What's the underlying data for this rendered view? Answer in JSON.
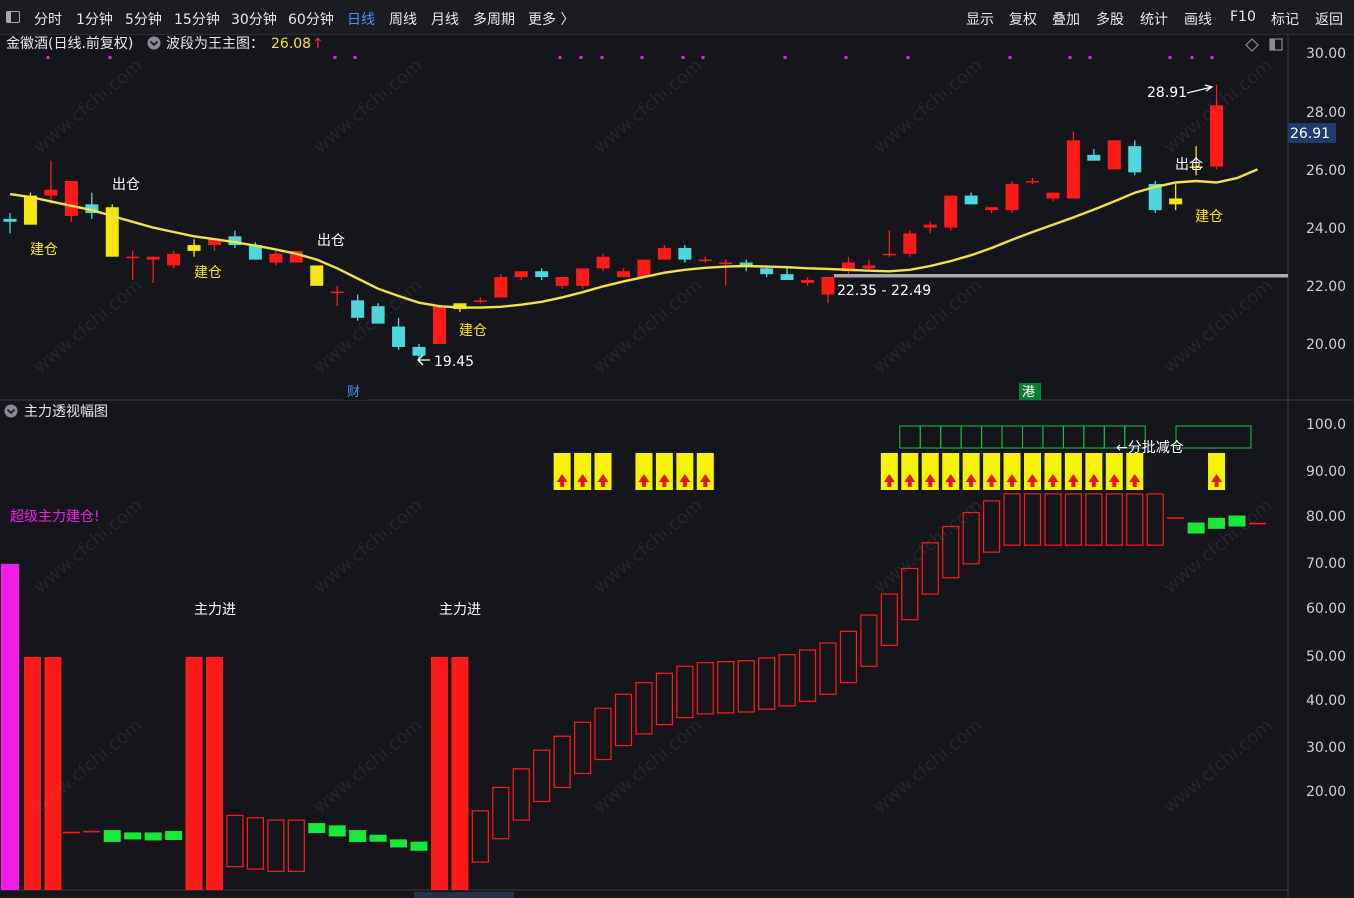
{
  "toolbar": {
    "periods": [
      "分时",
      "1分钟",
      "5分钟",
      "15分钟",
      "30分钟",
      "60分钟",
      "日线",
      "周线",
      "月线",
      "多周期",
      "更多 〉"
    ],
    "active_period": "日线",
    "right_items": [
      "显示",
      "复权",
      "叠加",
      "多股",
      "统计",
      "画线",
      "F10",
      "标记",
      "返回"
    ]
  },
  "main_panel": {
    "title": "金徽酒(日线.前复权)",
    "indicator_name": "波段为王主图：",
    "indicator_value": "26.08",
    "indicator_arrow": "↑",
    "price_axis": [
      "30.00",
      "28.00",
      "26.00",
      "24.00",
      "22.00",
      "20.00"
    ],
    "current_price": "26.91",
    "high_label": "28.91",
    "low_label": "19.45",
    "range_label": "22.35 - 22.49",
    "markers": {
      "cai": "财",
      "gang": "港"
    },
    "signals": [
      {
        "text": "建仓",
        "type": "build"
      },
      {
        "text": "出仓",
        "type": "exit"
      },
      {
        "text": "建仓",
        "type": "build"
      },
      {
        "text": "出仓",
        "type": "exit"
      },
      {
        "text": "建仓",
        "type": "build"
      },
      {
        "text": "出仓",
        "type": "exit"
      },
      {
        "text": "建仓",
        "type": "build"
      }
    ]
  },
  "sub_panel": {
    "title": "主力透视幅图",
    "value_axis": [
      "100.0",
      "90.00",
      "80.00",
      "70.00",
      "60.00",
      "50.00",
      "40.00",
      "30.00",
      "20.00"
    ],
    "super_label": "超级主力建仓!",
    "main_force_label": "主力进",
    "reduce_label": "←分批减仓"
  },
  "watermark": "www.cfchi.com",
  "colors": {
    "background": "#15161c",
    "up": "#ff1a1a",
    "down": "#4fd6dc",
    "ma": "#f2e24a",
    "signal": "#f5e60d",
    "green_bar": "#18e83a",
    "magenta": "#f01ee6",
    "accent": "#4f8ff7"
  },
  "chart_data": {
    "type": "candlestick",
    "price_range": [
      19,
      30.3
    ],
    "candles": [
      {
        "o": 24.3,
        "h": 24.5,
        "l": 23.8,
        "c": 24.2
      },
      {
        "o": 25.1,
        "h": 25.2,
        "l": 24.1,
        "c": 24.1
      },
      {
        "o": 25.1,
        "h": 26.3,
        "l": 24.8,
        "c": 25.3
      },
      {
        "o": 24.4,
        "h": 25.6,
        "l": 24.2,
        "c": 25.6
      },
      {
        "o": 24.8,
        "h": 25.2,
        "l": 24.3,
        "c": 24.5
      },
      {
        "o": 24.7,
        "h": 24.8,
        "l": 23.0,
        "c": 23.0
      },
      {
        "o": 23.0,
        "h": 23.2,
        "l": 22.2,
        "c": 23.0
      },
      {
        "o": 22.9,
        "h": 23.0,
        "l": 22.1,
        "c": 23.0
      },
      {
        "o": 22.7,
        "h": 23.2,
        "l": 22.6,
        "c": 23.1
      },
      {
        "o": 23.2,
        "h": 23.6,
        "l": 23.0,
        "c": 23.4
      },
      {
        "o": 23.4,
        "h": 23.6,
        "l": 23.2,
        "c": 23.6
      },
      {
        "o": 23.7,
        "h": 23.9,
        "l": 23.3,
        "c": 23.4
      },
      {
        "o": 23.4,
        "h": 23.5,
        "l": 22.9,
        "c": 22.9
      },
      {
        "o": 22.8,
        "h": 23.2,
        "l": 22.7,
        "c": 23.1
      },
      {
        "o": 22.8,
        "h": 23.2,
        "l": 22.8,
        "c": 23.2
      },
      {
        "o": 22.7,
        "h": 22.7,
        "l": 22.0,
        "c": 22.0
      },
      {
        "o": 21.8,
        "h": 22.0,
        "l": 21.3,
        "c": 21.8
      },
      {
        "o": 21.5,
        "h": 21.7,
        "l": 20.8,
        "c": 20.9
      },
      {
        "o": 21.3,
        "h": 21.4,
        "l": 20.7,
        "c": 20.7
      },
      {
        "o": 20.6,
        "h": 20.9,
        "l": 19.8,
        "c": 19.9
      },
      {
        "o": 19.9,
        "h": 20.0,
        "l": 19.45,
        "c": 19.6
      },
      {
        "o": 20.0,
        "h": 21.3,
        "l": 20.0,
        "c": 21.3
      },
      {
        "o": 21.2,
        "h": 21.4,
        "l": 21.1,
        "c": 21.4
      },
      {
        "o": 21.5,
        "h": 21.6,
        "l": 21.4,
        "c": 21.5
      },
      {
        "o": 21.6,
        "h": 22.4,
        "l": 21.6,
        "c": 22.3
      },
      {
        "o": 22.3,
        "h": 22.5,
        "l": 22.2,
        "c": 22.5
      },
      {
        "o": 22.5,
        "h": 22.6,
        "l": 22.2,
        "c": 22.3
      },
      {
        "o": 22.0,
        "h": 22.3,
        "l": 21.9,
        "c": 22.3
      },
      {
        "o": 22.0,
        "h": 22.6,
        "l": 21.9,
        "c": 22.6
      },
      {
        "o": 22.6,
        "h": 23.1,
        "l": 22.5,
        "c": 23.0
      },
      {
        "o": 22.3,
        "h": 22.6,
        "l": 22.3,
        "c": 22.5
      },
      {
        "o": 22.3,
        "h": 22.9,
        "l": 22.3,
        "c": 22.9
      },
      {
        "o": 22.9,
        "h": 23.4,
        "l": 22.9,
        "c": 23.3
      },
      {
        "o": 23.3,
        "h": 23.4,
        "l": 22.8,
        "c": 22.9
      },
      {
        "o": 22.9,
        "h": 23.0,
        "l": 22.8,
        "c": 22.9
      },
      {
        "o": 22.8,
        "h": 22.9,
        "l": 22.0,
        "c": 22.8
      },
      {
        "o": 22.8,
        "h": 22.9,
        "l": 22.5,
        "c": 22.7
      },
      {
        "o": 22.6,
        "h": 22.7,
        "l": 22.3,
        "c": 22.4
      },
      {
        "o": 22.4,
        "h": 22.6,
        "l": 22.2,
        "c": 22.2
      },
      {
        "o": 22.1,
        "h": 22.3,
        "l": 22.0,
        "c": 22.2
      },
      {
        "o": 21.7,
        "h": 22.3,
        "l": 21.4,
        "c": 22.3
      },
      {
        "o": 22.5,
        "h": 23.0,
        "l": 22.4,
        "c": 22.8
      },
      {
        "o": 22.6,
        "h": 22.9,
        "l": 22.5,
        "c": 22.7
      },
      {
        "o": 23.1,
        "h": 23.9,
        "l": 23.0,
        "c": 23.1
      },
      {
        "o": 23.1,
        "h": 23.9,
        "l": 23.0,
        "c": 23.8
      },
      {
        "o": 24.0,
        "h": 24.2,
        "l": 23.8,
        "c": 24.1
      },
      {
        "o": 24.0,
        "h": 25.1,
        "l": 23.9,
        "c": 25.1
      },
      {
        "o": 25.1,
        "h": 25.2,
        "l": 24.8,
        "c": 24.8
      },
      {
        "o": 24.6,
        "h": 24.7,
        "l": 24.5,
        "c": 24.7
      },
      {
        "o": 24.6,
        "h": 25.6,
        "l": 24.5,
        "c": 25.5
      },
      {
        "o": 25.6,
        "h": 25.7,
        "l": 25.5,
        "c": 25.6
      },
      {
        "o": 25.0,
        "h": 25.2,
        "l": 24.9,
        "c": 25.2
      },
      {
        "o": 25.0,
        "h": 27.3,
        "l": 25.0,
        "c": 27.0
      },
      {
        "o": 26.5,
        "h": 26.7,
        "l": 26.3,
        "c": 26.3
      },
      {
        "o": 26.0,
        "h": 27.0,
        "l": 26.0,
        "c": 27.0
      },
      {
        "o": 26.8,
        "h": 27.0,
        "l": 25.8,
        "c": 25.9
      },
      {
        "o": 25.5,
        "h": 25.6,
        "l": 24.5,
        "c": 24.6
      },
      {
        "o": 24.8,
        "h": 25.5,
        "l": 24.6,
        "c": 25.0
      },
      {
        "o": 26.1,
        "h": 26.8,
        "l": 25.8,
        "c": 26.1
      },
      {
        "o": 26.1,
        "h": 28.91,
        "l": 26.0,
        "c": 28.2
      }
    ],
    "ma_series": [
      25.15,
      25.05,
      24.9,
      24.75,
      24.6,
      24.4,
      24.2,
      24.0,
      23.85,
      23.7,
      23.6,
      23.5,
      23.38,
      23.25,
      23.1,
      22.9,
      22.6,
      22.25,
      21.9,
      21.65,
      21.42,
      21.3,
      21.25,
      21.25,
      21.28,
      21.35,
      21.45,
      21.6,
      21.78,
      21.98,
      22.15,
      22.3,
      22.45,
      22.55,
      22.62,
      22.66,
      22.68,
      22.66,
      22.64,
      22.6,
      22.58,
      22.55,
      22.52,
      22.5,
      22.55,
      22.68,
      22.85,
      23.05,
      23.3,
      23.58,
      23.85,
      24.1,
      24.35,
      24.62,
      24.9,
      25.2,
      25.4,
      25.55,
      25.6,
      25.55,
      25.7,
      26.0
    ],
    "sub_values": [
      70,
      50,
      50,
      12.5,
      12.7,
      12.0,
      11.5,
      11.5,
      11.8,
      50,
      50,
      16,
      15.5,
      15,
      15,
      13.5,
      13,
      12,
      11,
      10,
      9.5,
      50,
      50,
      17,
      22,
      26,
      30,
      33,
      36,
      39,
      42,
      44.5,
      46.5,
      48,
      48.8,
      49,
      49.2,
      49.8,
      50.5,
      51.5,
      53,
      55.5,
      59,
      63.5,
      69,
      74.5,
      78,
      81,
      83.5,
      85,
      85,
      85,
      85,
      85,
      85,
      85,
      85,
      80,
      78,
      79,
      79.5,
      78.8
    ],
    "sub_types": [
      "magenta",
      "solid",
      "solid",
      "rline",
      "rline",
      "green",
      "green",
      "green",
      "green",
      "solid",
      "solid",
      "hollow",
      "hollow",
      "hollow",
      "hollow",
      "green",
      "green",
      "green",
      "green",
      "green",
      "green",
      "solid",
      "solid",
      "hollow",
      "hollow",
      "hollow",
      "hollow",
      "hollow",
      "hollow",
      "hollow",
      "hollow",
      "hollow",
      "hollow",
      "hollow",
      "hollow",
      "hollow",
      "hollow",
      "hollow",
      "hollow",
      "hollow",
      "hollow",
      "hollow",
      "hollow",
      "hollow",
      "hollow",
      "hollow",
      "hollow",
      "hollow",
      "hollow",
      "hollow",
      "hollow",
      "hollow",
      "hollow",
      "hollow",
      "hollow",
      "hollow",
      "hollow",
      "rline",
      "green",
      "green",
      "green",
      "rline"
    ]
  }
}
